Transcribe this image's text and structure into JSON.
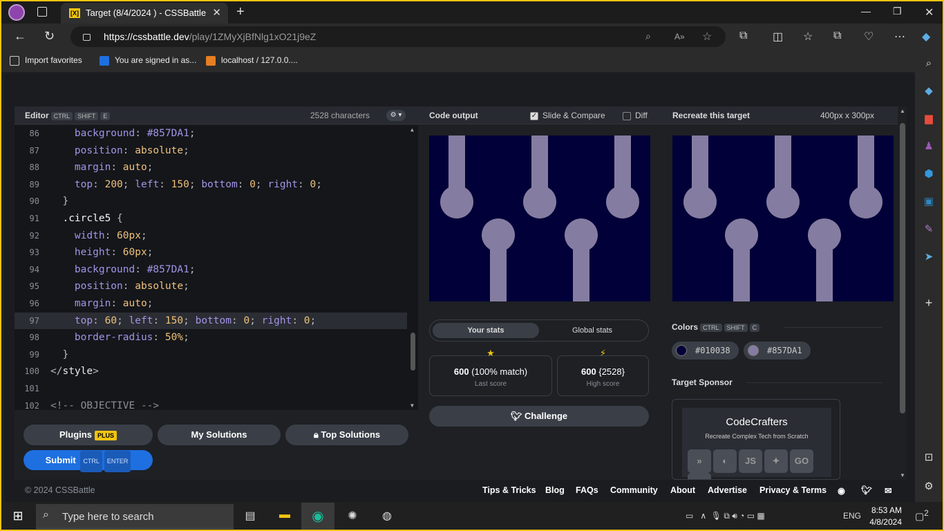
{
  "browser": {
    "tab_title": "Target (8/4/2024 ) - CSSBattle",
    "tab_favicon": "[X]",
    "url_host": "https://cssbattle.dev",
    "url_path": "/play/1ZMyXjBfNlg1xO21j9eZ",
    "favorites": [
      "Import favorites",
      "You are signed in as...",
      "localhost / 127.0.0...."
    ]
  },
  "editor": {
    "title": "Editor",
    "shortcut": [
      "CTRL",
      "SHIFT",
      "E"
    ],
    "characters": "2528 characters",
    "lines": [
      {
        "n": "86",
        "code": [
          [
            "    ",
            ""
          ],
          [
            "background",
            "p"
          ],
          [
            ": ",
            "pun"
          ],
          [
            "#857DA1",
            "p"
          ],
          [
            ";",
            "pun"
          ]
        ]
      },
      {
        "n": "87",
        "code": [
          [
            "    ",
            ""
          ],
          [
            "position",
            "p"
          ],
          [
            ": ",
            "pun"
          ],
          [
            "absolute",
            "v"
          ],
          [
            ";",
            "pun"
          ]
        ]
      },
      {
        "n": "88",
        "code": [
          [
            "    ",
            ""
          ],
          [
            "margin",
            "p"
          ],
          [
            ": ",
            "pun"
          ],
          [
            "auto",
            "v"
          ],
          [
            ";",
            "pun"
          ]
        ]
      },
      {
        "n": "89",
        "code": [
          [
            "    ",
            ""
          ],
          [
            "top",
            "p"
          ],
          [
            ": ",
            "pun"
          ],
          [
            "200",
            "n"
          ],
          [
            "; ",
            "pun"
          ],
          [
            "left",
            "p"
          ],
          [
            ": ",
            "pun"
          ],
          [
            "150",
            "n"
          ],
          [
            "; ",
            "pun"
          ],
          [
            "bottom",
            "p"
          ],
          [
            ": ",
            "pun"
          ],
          [
            "0",
            "n"
          ],
          [
            "; ",
            "pun"
          ],
          [
            "right",
            "p"
          ],
          [
            ": ",
            "pun"
          ],
          [
            "0",
            "n"
          ],
          [
            ";",
            "pun"
          ]
        ]
      },
      {
        "n": "90",
        "code": [
          [
            "  }",
            "pun"
          ]
        ]
      },
      {
        "n": "91",
        "code": [
          [
            "  .circle5 ",
            "sel"
          ],
          [
            "{",
            "pun"
          ]
        ]
      },
      {
        "n": "92",
        "code": [
          [
            "    ",
            ""
          ],
          [
            "width",
            "p"
          ],
          [
            ": ",
            "pun"
          ],
          [
            "60",
            "n"
          ],
          [
            "px",
            "v"
          ],
          [
            ";",
            "pun"
          ]
        ]
      },
      {
        "n": "93",
        "code": [
          [
            "    ",
            ""
          ],
          [
            "height",
            "p"
          ],
          [
            ": ",
            "pun"
          ],
          [
            "60",
            "n"
          ],
          [
            "px",
            "v"
          ],
          [
            ";",
            "pun"
          ]
        ]
      },
      {
        "n": "94",
        "code": [
          [
            "    ",
            ""
          ],
          [
            "background",
            "p"
          ],
          [
            ": ",
            "pun"
          ],
          [
            "#857DA1",
            "p"
          ],
          [
            ";",
            "pun"
          ]
        ]
      },
      {
        "n": "95",
        "code": [
          [
            "    ",
            ""
          ],
          [
            "position",
            "p"
          ],
          [
            ": ",
            "pun"
          ],
          [
            "absolute",
            "v"
          ],
          [
            ";",
            "pun"
          ]
        ]
      },
      {
        "n": "96",
        "code": [
          [
            "    ",
            ""
          ],
          [
            "margin",
            "p"
          ],
          [
            ": ",
            "pun"
          ],
          [
            "auto",
            "v"
          ],
          [
            ";",
            "pun"
          ]
        ]
      },
      {
        "n": "97",
        "code": [
          [
            "    ",
            ""
          ],
          [
            "top",
            "p"
          ],
          [
            ": ",
            "pun"
          ],
          [
            "60",
            "n"
          ],
          [
            "; ",
            "pun"
          ],
          [
            "left",
            "p"
          ],
          [
            ": ",
            "pun"
          ],
          [
            "150",
            "n"
          ],
          [
            "; ",
            "pun"
          ],
          [
            "bottom",
            "p"
          ],
          [
            ": ",
            "pun"
          ],
          [
            "0",
            "n"
          ],
          [
            "; ",
            "pun"
          ],
          [
            "right",
            "p"
          ],
          [
            ": ",
            "pun"
          ],
          [
            "0",
            "n"
          ],
          [
            ";",
            "pun"
          ]
        ],
        "active": true
      },
      {
        "n": "98",
        "code": [
          [
            "    ",
            ""
          ],
          [
            "border-radius",
            "p"
          ],
          [
            ": ",
            "pun"
          ],
          [
            "50",
            "n"
          ],
          [
            "%",
            "v"
          ],
          [
            ";",
            "pun"
          ]
        ]
      },
      {
        "n": "99",
        "code": [
          [
            "  }",
            "pun"
          ]
        ]
      },
      {
        "n": "100",
        "code": [
          [
            "</",
            "tag"
          ],
          [
            "style",
            "tn"
          ],
          [
            ">",
            "tag"
          ]
        ]
      },
      {
        "n": "101",
        "code": []
      },
      {
        "n": "102",
        "code": [
          [
            "<!-- OBJECTIVE -->",
            "cm"
          ]
        ]
      }
    ]
  },
  "buttons": {
    "plugins": "Plugins",
    "plugins_badge": "PLUS",
    "my_solutions": "My Solutions",
    "top_solutions": "Top Solutions",
    "submit": "Submit",
    "submit_keys": [
      "CTRL",
      "ENTER"
    ]
  },
  "output": {
    "title": "Code output",
    "slide_compare": "Slide & Compare",
    "slide_compare_checked": true,
    "diff": "Diff",
    "diff_checked": false
  },
  "target": {
    "title": "Recreate this target",
    "size": "400px x 300px"
  },
  "stats": {
    "tab_yours": "Your stats",
    "tab_global": "Global stats",
    "last_score": "600",
    "last_match": "(100% match)",
    "last_label": "Last score",
    "high_score": "600",
    "high_chars": "{2528}",
    "high_label": "High score",
    "challenge": "Challenge"
  },
  "colors": {
    "title": "Colors",
    "shortcut": [
      "CTRL",
      "SHIFT",
      "C"
    ],
    "swatches": [
      {
        "hex": "#010038",
        "label": "#010038"
      },
      {
        "hex": "#857DA1",
        "label": "#857DA1"
      }
    ]
  },
  "sponsor": {
    "title": "Target Sponsor",
    "name": "CodeCrafters",
    "tagline": "Recreate Complex Tech from Scratch"
  },
  "footer": {
    "copyright": "© 2024 CSSBattle",
    "links": [
      "Tips & Tricks",
      "Blog",
      "FAQs",
      "Community",
      "About",
      "Advertise",
      "Privacy & Terms"
    ]
  },
  "taskbar": {
    "search_placeholder": "Type here to search",
    "lang": "ENG",
    "time": "8:53 AM",
    "date": "4/8/2024",
    "notifications": "2"
  },
  "theme": {
    "accent": "#1e6fe0",
    "bg": "#010038",
    "fg": "#857DA1",
    "highlight": "#f1c40f"
  }
}
